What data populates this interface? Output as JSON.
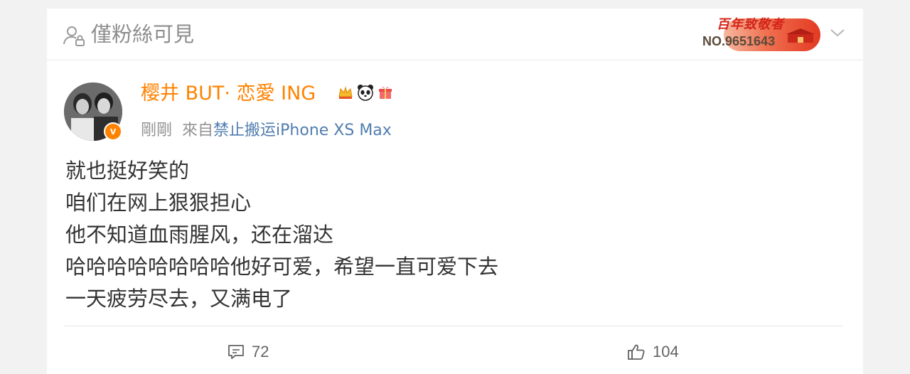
{
  "header": {
    "visibility_icon": "user-lock-icon",
    "visibility_label": "僅粉絲可見",
    "badge": {
      "title": "百年致敬者",
      "number": "NO.9651643"
    },
    "menu_icon": "chevron-down-icon"
  },
  "post": {
    "author": {
      "name": "樱井 BUT· 恋愛 ING",
      "verified_icon": "verified-v-icon",
      "emoji_icons": [
        "crown-emoji-icon",
        "panda-emoji-icon",
        "gift-emoji-icon"
      ]
    },
    "meta": {
      "time": "剛剛",
      "from_prefix": "來自",
      "source": "禁止搬运iPhone XS Max"
    },
    "lines": [
      "就也挺好笑的",
      "咱们在网上狠狠担心",
      "他不知道血雨腥风，还在溜达",
      "哈哈哈哈哈哈哈哈他好可爱，希望一直可爱下去",
      "一天疲劳尽去，又满电了"
    ]
  },
  "actions": {
    "comment_icon": "comment-icon",
    "comment_count": "72",
    "like_icon": "thumbs-up-icon",
    "like_count": "104"
  },
  "colors": {
    "author": "#ff8200",
    "source_link": "#507daf",
    "meta": "#939393",
    "text": "#333333"
  }
}
